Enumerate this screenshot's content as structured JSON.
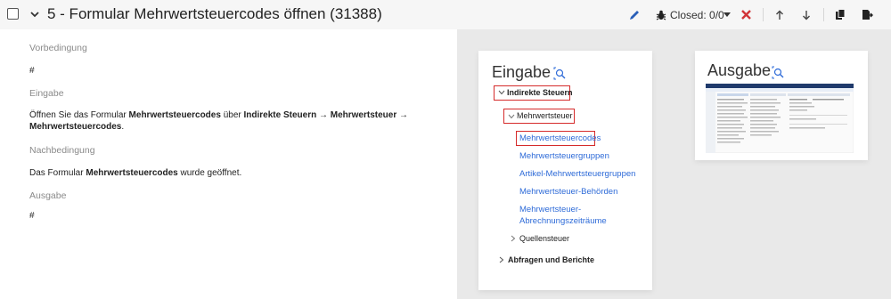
{
  "header": {
    "title": "5 - Formular Mehrwertsteuercodes öffnen (31388)",
    "closed_label": "Closed: 0/0"
  },
  "details": {
    "precondition_label": "Vorbedingung",
    "precondition_value": "#",
    "input_label": "Eingabe",
    "input_text": {
      "p1": "Öffnen Sie das Formular ",
      "b1": "Mehrwertsteuercodes",
      "p2": " über ",
      "b2": "Indirekte Steuern",
      "arrow1": " → ",
      "b3": "Mehrwertsteuer",
      "arrow2": " → ",
      "b4": "Mehrwertsteuercodes",
      "p3": "."
    },
    "postcondition_label": "Nachbedingung",
    "postcondition_text": {
      "p1": "Das Formular ",
      "b1": "Mehrwertsteuercodes",
      "p2": " wurde geöffnet."
    },
    "output_label": "Ausgabe",
    "output_value": "#"
  },
  "input_card": {
    "title": "Eingabe",
    "menu": {
      "indirect_taxes": "Indirekte Steuern",
      "vat": "Mehrwertsteuer",
      "vat_codes": "Mehrwertsteuercodes",
      "vat_groups": "Mehrwertsteuergruppen",
      "item_vat_groups": "Artikel-Mehrwertsteuergruppen",
      "vat_authorities": "Mehrwertsteuer-Behörden",
      "vat_periods_line1": "Mehrwertsteuer-",
      "vat_periods_line2": "Abrechnungszeiträume",
      "withholding_tax": "Quellensteuer",
      "queries_reports": "Abfragen und Berichte"
    }
  },
  "output_card": {
    "title": "Ausgabe"
  },
  "colors": {
    "accent_blue": "#2e6bd8",
    "highlight_red": "#d52b2b",
    "close_red": "#d13438"
  }
}
